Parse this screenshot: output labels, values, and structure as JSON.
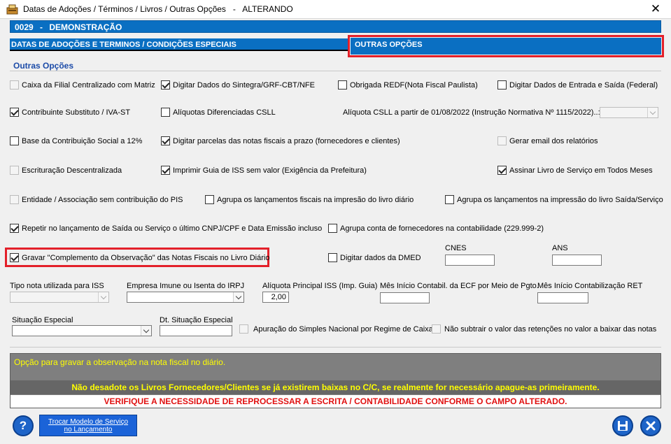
{
  "window": {
    "title": "Datas de Adoções / Términos / Livros / Outras Opções   -   ALTERANDO",
    "close": "✕"
  },
  "company": {
    "code": "0029",
    "separator": "-",
    "name": "DEMONSTRAÇÃO"
  },
  "tabs": {
    "dates": "DATAS DE ADOÇÕES E TERMINOS / CONDIÇÕES ESPECIAIS",
    "other": "OUTRAS OPÇÕES"
  },
  "section_title": "Outras Opções",
  "options": {
    "caixa_filial": "Caixa da Filial Centralizado com Matriz",
    "sintegra": "Digitar Dados do Sintegra/GRF-CBT/NFE",
    "redf": "Obrigada REDF(Nota Fiscal Paulista)",
    "entrada_saida": "Digitar Dados de Entrada e Saída (Federal)",
    "iva_st": "Contribuinte Substituto / IVA-ST",
    "csll_aliq": "Alíquotas Diferenciadas CSLL",
    "csll_label": "Alíquota CSLL a partir de 01/08/2022 (Instrução Normativa Nº 1115/2022)..:",
    "contrib_social": "Base da Contribuição Social a 12%",
    "parcelas": "Digitar parcelas das notas fiscais a prazo (fornecedores e clientes)",
    "email": "Gerar email dos relatórios",
    "escrituracao": "Escrituração Descentralizada",
    "guia_iss": "Imprimir Guia de ISS sem valor (Exigência da Prefeitura)",
    "assinar": "Assinar Livro de Serviço em Todos Meses",
    "entidade": "Entidade / Associação sem contribuição do PIS",
    "agrupa_diario": "Agrupa os lançamentos fiscais na impresão do livro diário",
    "agrupa_saida": "Agrupa os lançamentos na impressão do livro Saída/Serviço",
    "repetir": "Repetir no lançamento de Saída ou Serviço o último CNPJ/CPF e Data Emissão incluso",
    "agrupa_conta": "Agrupa conta de fornecedores na contabilidade (229.999-2)",
    "gravar": "Gravar \"Complemento da Observação\" das Notas Fiscais no Livro Diário",
    "dmed": "Digitar dados da DMED",
    "simples": "Apuração do Simples Nacional por Regime de Caixa",
    "retencoes": "Não subtrair o valor das retenções no valor a baixar das notas"
  },
  "fields": {
    "cnes_label": "CNES",
    "ans_label": "ANS",
    "tipo_nota_label": "Tipo nota utilizada para ISS",
    "empresa_imune_label": "Empresa Imune ou Isenta do IRPJ",
    "aliq_iss_label": "Alíquota Principal ISS (Imp. Guia)",
    "aliq_iss_value": "2,00",
    "mes_ecf_label": "Mês Início Contabil. da ECF por Meio de Pgto.",
    "mes_ret_label": "Mês Início Contabilização RET",
    "situacao_label": "Situação Especial",
    "dt_situacao_label": "Dt. Situação Especial"
  },
  "info": {
    "hint": "Opção para gravar a observação na nota fiscal no diário.",
    "warning1": "Não desadote os Livros Fornecedores/Clientes se já existirem baixas no C/C, se realmente for necessário apague-as primeiramente.",
    "warning2": "VERIFIQUE A NECESSIDADE DE REPROCESSAR A ESCRITA / CONTABILIDADE CONFORME O CAMPO ALTERADO."
  },
  "buttons": {
    "help": "?",
    "swap_line1": "Trocar Modelo de Serviço",
    "swap_line2": "no Lançamento"
  },
  "colors": {
    "accent": "#0a6fc2",
    "highlight": "#e3202a",
    "warning_yellow": "#ffff00",
    "warning_red": "#e01010"
  }
}
